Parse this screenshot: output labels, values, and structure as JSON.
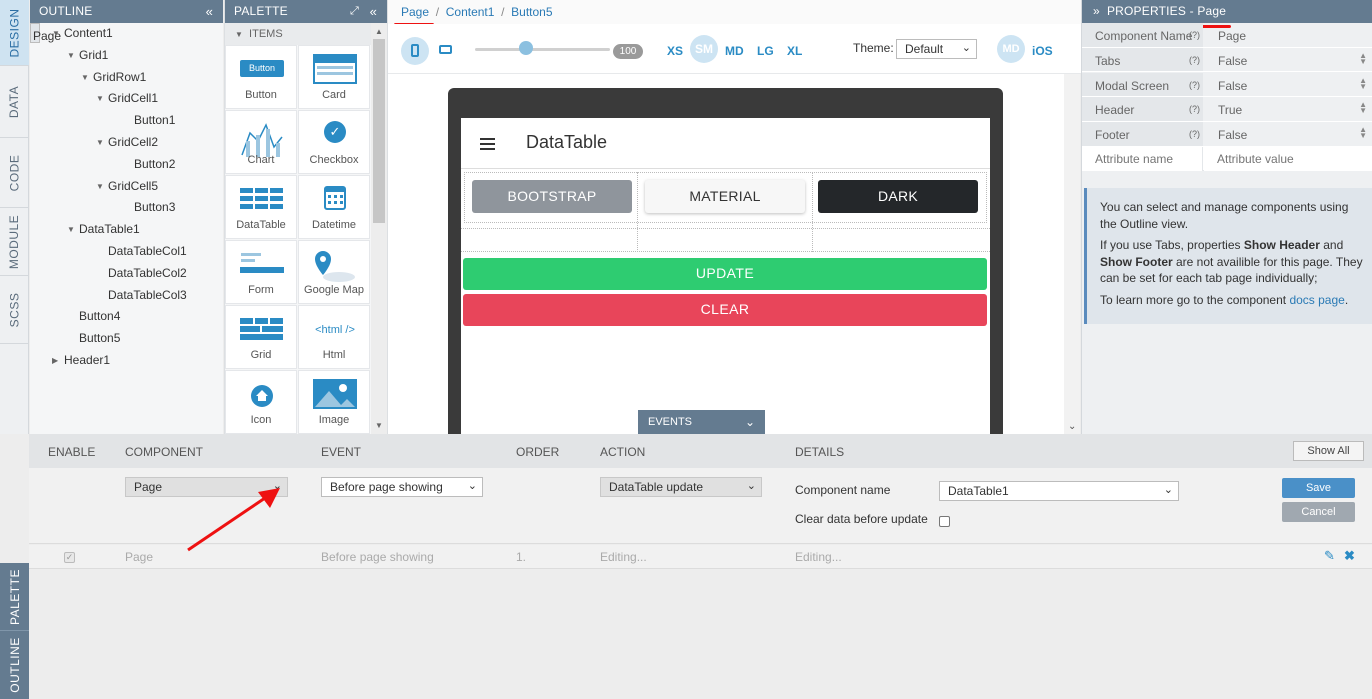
{
  "left_tabs": [
    "DESIGN",
    "DATA",
    "CODE",
    "MODULE",
    "SCSS"
  ],
  "bottom_tabs": [
    "PALETTE",
    "OUTLINE"
  ],
  "outline": {
    "title": "OUTLINE",
    "tree": [
      {
        "label": "Page",
        "level": 0,
        "expander": "none",
        "selected": true
      },
      {
        "label": "Content1",
        "level": 1,
        "expander": "open"
      },
      {
        "label": "Grid1",
        "level": 2,
        "expander": "open"
      },
      {
        "label": "GridRow1",
        "level": 3,
        "expander": "open"
      },
      {
        "label": "GridCell1",
        "level": 4,
        "expander": "open"
      },
      {
        "label": "Button1",
        "level": 5,
        "expander": "none"
      },
      {
        "label": "GridCell2",
        "level": 4,
        "expander": "open"
      },
      {
        "label": "Button2",
        "level": 5,
        "expander": "none"
      },
      {
        "label": "GridCell5",
        "level": 4,
        "expander": "open"
      },
      {
        "label": "Button3",
        "level": 5,
        "expander": "none"
      },
      {
        "label": "DataTable1",
        "level": 2,
        "expander": "open"
      },
      {
        "label": "DataTableCol1",
        "level": 4,
        "expander": "none"
      },
      {
        "label": "DataTableCol2",
        "level": 4,
        "expander": "none"
      },
      {
        "label": "DataTableCol3",
        "level": 4,
        "expander": "none"
      },
      {
        "label": "Button4",
        "level": 2,
        "expander": "none"
      },
      {
        "label": "Button5",
        "level": 2,
        "expander": "none"
      },
      {
        "label": "Header1",
        "level": 1,
        "expander": "closed"
      }
    ]
  },
  "palette": {
    "title": "PALETTE",
    "section": "ITEMS",
    "items": [
      {
        "label": "Button",
        "icon": "button-icon"
      },
      {
        "label": "Card",
        "icon": "card-icon"
      },
      {
        "label": "Chart",
        "icon": "chart-icon"
      },
      {
        "label": "Checkbox",
        "icon": "checkbox-icon"
      },
      {
        "label": "DataTable",
        "icon": "datatable-icon"
      },
      {
        "label": "Datetime",
        "icon": "calendar-icon"
      },
      {
        "label": "Form",
        "icon": "form-icon"
      },
      {
        "label": "Google Map",
        "icon": "map-pin-icon"
      },
      {
        "label": "Grid",
        "icon": "grid-icon"
      },
      {
        "label": "Html",
        "icon": "html-icon"
      },
      {
        "label": "Icon",
        "icon": "home-icon"
      },
      {
        "label": "Image",
        "icon": "image-icon"
      }
    ],
    "button_icon_text": "Button",
    "html_icon_text": "<html />"
  },
  "breadcrumb": [
    "Page",
    "Content1",
    "Button5"
  ],
  "toolbar": {
    "zoom": "100",
    "breakpoints": [
      "XS",
      "SM",
      "MD",
      "LG",
      "XL"
    ],
    "active_breakpoint": "SM",
    "theme_label": "Theme:",
    "theme_value": "Default",
    "platform_md": "MD",
    "platform_ios": "iOS"
  },
  "preview": {
    "title": "DataTable",
    "buttons": [
      "BOOTSTRAP",
      "MATERIAL",
      "DARK"
    ],
    "update": "UPDATE",
    "clear": "CLEAR",
    "events_tab": "EVENTS"
  },
  "properties": {
    "title": "PROPERTIES - Page",
    "rows": [
      {
        "key": "Component Name",
        "help": "(?)",
        "value": "Page",
        "spinner": false
      },
      {
        "key": "Tabs",
        "help": "(?)",
        "value": "False",
        "spinner": true
      },
      {
        "key": "Modal Screen",
        "help": "(?)",
        "value": "False",
        "spinner": true
      },
      {
        "key": "Header",
        "help": "(?)",
        "value": "True",
        "spinner": true
      },
      {
        "key": "Footer",
        "help": "(?)",
        "value": "False",
        "spinner": true
      }
    ],
    "attr_name_placeholder": "Attribute name",
    "attr_value_placeholder": "Attribute value",
    "info_p1": "You can select and manage components using the Outline view.",
    "info_p2_a": "If you use Tabs, properties ",
    "info_p2_b": "Show Header",
    "info_p2_c": " and ",
    "info_p2_d": "Show Footer",
    "info_p2_e": " are not availible for this page. They can be set for each tab page individually;",
    "info_p3_a": "To learn more go to the component ",
    "info_p3_link": "docs page",
    "info_p3_b": "."
  },
  "events": {
    "headers": {
      "enable": "ENABLE",
      "component": "COMPONENT",
      "event": "EVENT",
      "order": "ORDER",
      "action": "ACTION",
      "details": "DETAILS"
    },
    "show_all": "Show All",
    "edit": {
      "component": "Page",
      "event": "Before page showing",
      "action": "DataTable update",
      "component_name_label": "Component name",
      "component_name_value": "DataTable1",
      "clear_label": "Clear data before update",
      "save": "Save",
      "cancel": "Cancel"
    },
    "row": {
      "component": "Page",
      "event": "Before page showing",
      "order": "1.",
      "action": "Editing...",
      "details": "Editing..."
    }
  },
  "colors": {
    "header_bg": "#647b90",
    "update_green": "#2ecc71",
    "clear_red": "#e8455a",
    "save_blue": "#4a90c8",
    "cancel_gray": "#a0a8b0",
    "annotation_red": "#e11111"
  }
}
